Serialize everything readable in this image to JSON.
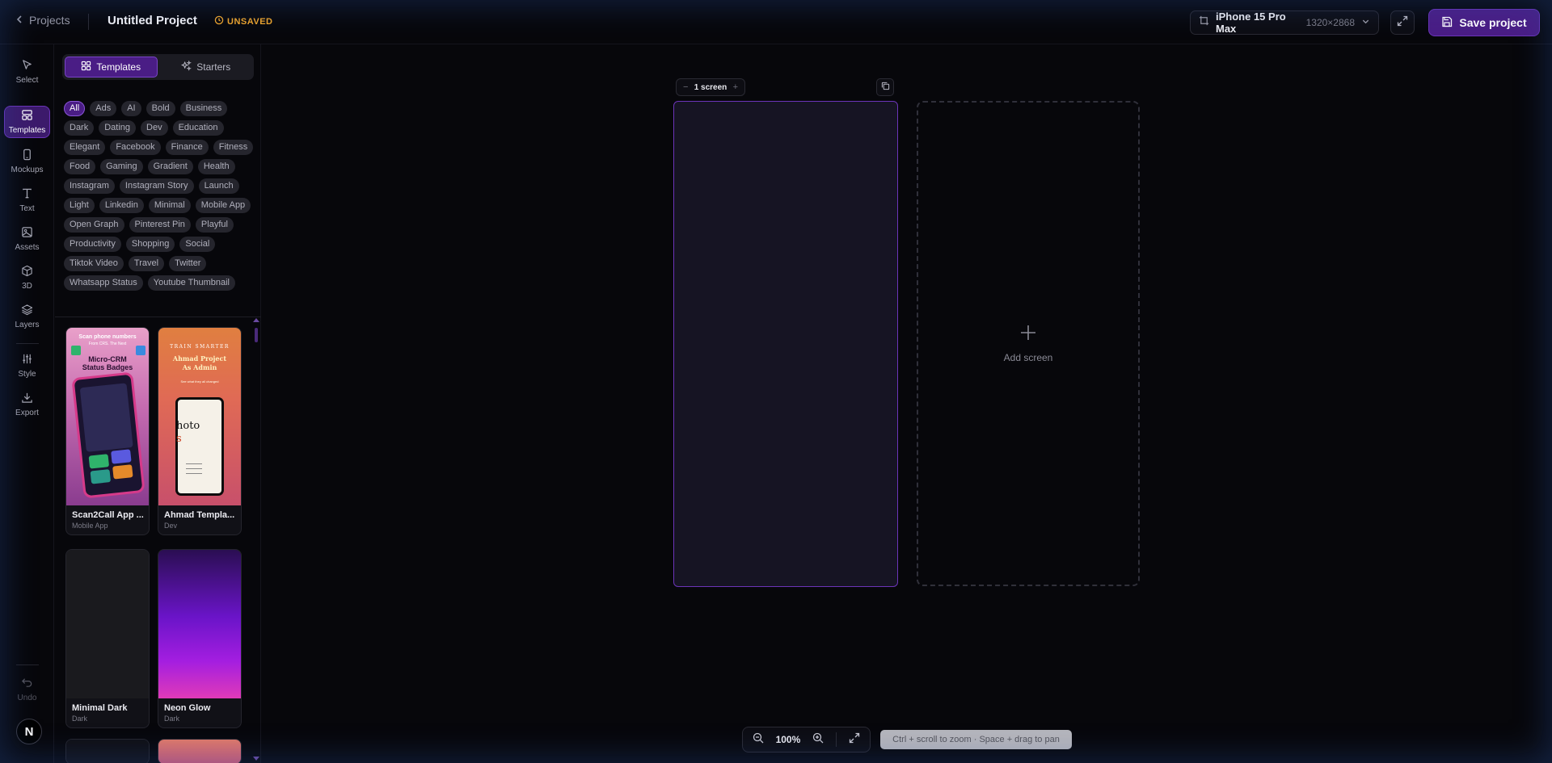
{
  "topbar": {
    "back_label": "Projects",
    "project_title": "Untitled Project",
    "status": "UNSAVED",
    "device_name": "iPhone 15 Pro Max",
    "device_resolution": "1320×2868",
    "save_label": "Save project"
  },
  "rail": {
    "items": [
      {
        "label": "Select",
        "icon": "cursor-icon"
      },
      {
        "label": "Templates",
        "icon": "templates-icon",
        "active": true
      },
      {
        "label": "Mockups",
        "icon": "phone-icon"
      },
      {
        "label": "Text",
        "icon": "text-icon"
      },
      {
        "label": "Assets",
        "icon": "image-icon"
      },
      {
        "label": "3D",
        "icon": "cube-icon"
      },
      {
        "label": "Layers",
        "icon": "layers-icon"
      },
      {
        "label": "Style",
        "icon": "sliders-icon"
      },
      {
        "label": "Export",
        "icon": "download-icon"
      }
    ],
    "undo_label": "Undo",
    "avatar_initial": "N"
  },
  "panel": {
    "tabs": [
      {
        "label": "Templates",
        "active": true
      },
      {
        "label": "Starters",
        "active": false
      }
    ],
    "tags": [
      "All",
      "Ads",
      "AI",
      "Bold",
      "Business",
      "Dark",
      "Dating",
      "Dev",
      "Education",
      "Elegant",
      "Facebook",
      "Finance",
      "Fitness",
      "Food",
      "Gaming",
      "Gradient",
      "Health",
      "Instagram",
      "Instagram Story",
      "Launch",
      "Light",
      "Linkedin",
      "Minimal",
      "Mobile App",
      "Open Graph",
      "Pinterest Pin",
      "Playful",
      "Productivity",
      "Shopping",
      "Social",
      "Tiktok Video",
      "Travel",
      "Twitter",
      "Whatsapp Status",
      "Youtube Thumbnail"
    ],
    "active_tag": "All",
    "templates": [
      {
        "name": "Scan2Call App ...",
        "tag": "Mobile App",
        "thumb_text": [
          "Scan phone numbers",
          "From CRS. The Next",
          "Micro-CRM",
          "Status Badges"
        ]
      },
      {
        "name": "Ahmad Templa...",
        "tag": "Dev",
        "thumb_text": [
          "TRAIN SMARTER",
          "Ahmad Project",
          "As Admin",
          "See what they all changed",
          "hoto",
          "s"
        ]
      },
      {
        "name": "Minimal Dark",
        "tag": "Dark"
      },
      {
        "name": "Neon Glow",
        "tag": "Dark"
      }
    ]
  },
  "canvas": {
    "screen_count_label": "1 screen",
    "add_screen_label": "Add screen"
  },
  "zoom": {
    "value": "100%",
    "hint": "Ctrl + scroll to zoom · Space + drag to pan"
  },
  "colors": {
    "accent": "#4a1d85",
    "accent_border": "#6b34b8",
    "warning": "#f0a52b",
    "background": "#07070b"
  }
}
